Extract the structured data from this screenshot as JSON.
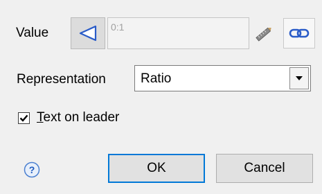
{
  "labels": {
    "value": "Value",
    "representation": "Representation"
  },
  "value_field": {
    "text": "0:1"
  },
  "representation": {
    "selected": "Ratio"
  },
  "checkbox": {
    "checked": true,
    "mnemonic": "T",
    "label_rest": "ext on leader"
  },
  "buttons": {
    "ok": "OK",
    "cancel": "Cancel"
  },
  "icons": {
    "selector": "triangle-left-icon",
    "measure": "ruler-pencil-icon",
    "link": "chain-link-icon",
    "help": "question-mark-icon",
    "dropdown": "caret-down-icon",
    "check": "checkmark-icon"
  },
  "colors": {
    "accent": "#0078d7",
    "dialog_bg": "#f0f0f0"
  }
}
